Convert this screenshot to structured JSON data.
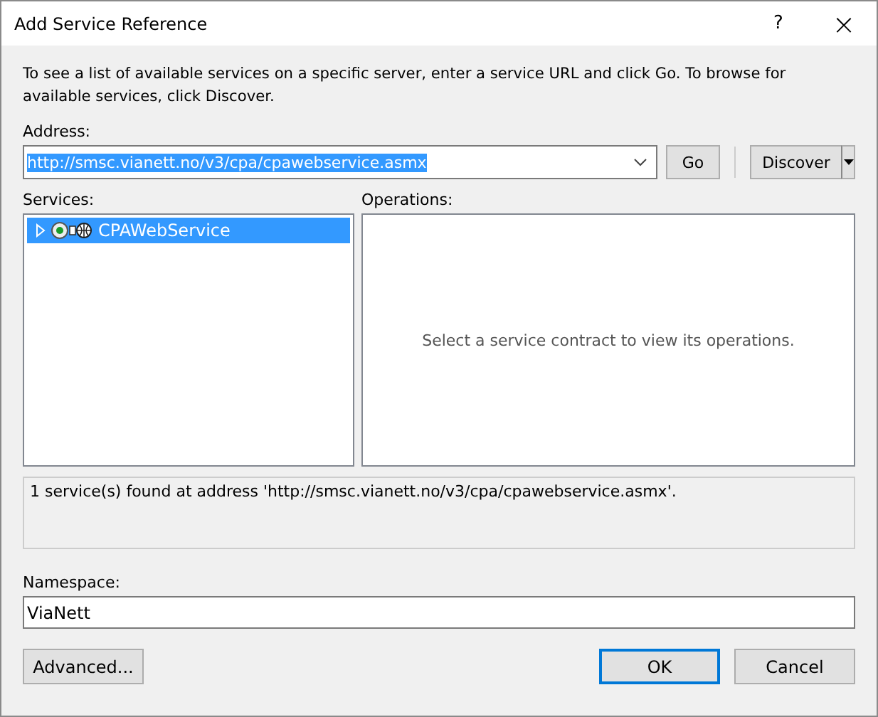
{
  "window": {
    "title": "Add Service Reference",
    "help": "?",
    "close": "×"
  },
  "intro": "To see a list of available services on a specific server, enter a service URL and click Go. To browse for available services, click Discover.",
  "address": {
    "label": "Address:",
    "value": "http://smsc.vianett.no/v3/cpa/cpawebservice.asmx",
    "text_selected": true
  },
  "go_button": "Go",
  "discover_button": "Discover",
  "services": {
    "label": "Services:",
    "items": [
      {
        "name": "CPAWebService",
        "selected": true,
        "expanded": false
      }
    ]
  },
  "operations": {
    "label": "Operations:",
    "message": "Select a service contract to view its operations."
  },
  "status": "1 service(s) found at address 'http://smsc.vianett.no/v3/cpa/cpawebservice.asmx'.",
  "namespace": {
    "label": "Namespace:",
    "value": "ViaNett"
  },
  "buttons": [
    {
      "label": "Advanced...",
      "default": false
    },
    {
      "label": "OK",
      "default": true
    },
    {
      "label": "Cancel",
      "default": false
    }
  ]
}
